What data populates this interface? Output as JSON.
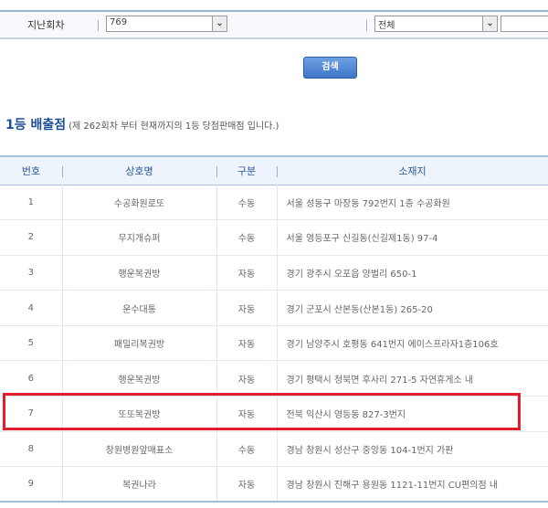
{
  "filter": {
    "round_label": "지난회차",
    "round_value": "769",
    "region_value": "전체",
    "text_value": ""
  },
  "search_button": "검색",
  "section": {
    "title": "1등 배출점",
    "note": "(제 262회차 부터 현재까지의 1등 당첨판매점 입니다.)"
  },
  "table": {
    "headers": [
      "번호",
      "상호명",
      "구분",
      "소재지"
    ],
    "rows": [
      [
        "1",
        "수공화원로또",
        "수동",
        "서울 성동구 마장동 792번지 1층 수공화원"
      ],
      [
        "2",
        "무지개슈퍼",
        "수동",
        "서울 영등포구 신길동(신길제1동) 97-4"
      ],
      [
        "3",
        "행운복권방",
        "자동",
        "경기 광주시 오포읍 양벌리 650-1"
      ],
      [
        "4",
        "운수대통",
        "자동",
        "경기 군포시 산본동(산본1동) 265-20"
      ],
      [
        "5",
        "패밀리복권방",
        "자동",
        "경기 남양주시 호평동 641번지 에이스프라자1층106호"
      ],
      [
        "6",
        "행운복권방",
        "자동",
        "경기 평택시 청북면 후사리 271-5 자연휴게소 내"
      ],
      [
        "7",
        "또또복권방",
        "자동",
        "전북 익산시 영등동 827-3번지"
      ],
      [
        "8",
        "창원병원앞매표소",
        "수동",
        "경남 창원시 성산구 중앙동 104-1번지 가판"
      ],
      [
        "9",
        "복권나라",
        "자동",
        "경남 창원시 진해구 용원동 1121-11번지 CU편의점 내"
      ]
    ],
    "highlighted_row": 7,
    "highlight_color": "#e21c2a"
  }
}
